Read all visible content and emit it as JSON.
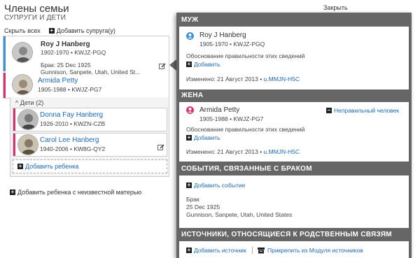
{
  "header": {
    "title": "Члены семьи",
    "subtitle": "СУПРУГИ И ДЕТИ",
    "close": "Закрыть"
  },
  "toolbar": {
    "hide_all": "Скрыть всех",
    "add_spouse": "Добавить супруга(у)"
  },
  "couple": {
    "husband": {
      "name": "Roy J Hanberg",
      "meta": "1902-1970 • KWJZ-PGQ"
    },
    "marriage": {
      "date": "Брак: 25 Dec 1925",
      "place": "Gunnison, Sanpete, Utah, United St..."
    },
    "wife": {
      "name": "Armida Petty",
      "meta": "1905-1988 • KWJZ-PG7"
    }
  },
  "children": {
    "header": "Дети (2)",
    "items": [
      {
        "name": "Donna Fay Hanberg",
        "meta": "1926-2010 • KWZN-CZB"
      },
      {
        "name": "Carol Lee Hanberg",
        "meta": "1940-2006 • KW8G-QY2"
      }
    ],
    "add_child": "Добавить ребенка"
  },
  "unknown_mother": "Добавить ребенка с неизвестной матерью",
  "panel": {
    "husband": {
      "header": "МУЖ",
      "name": "Roy J Hanberg",
      "meta": "1905-1970 • KWJZ-PGQ",
      "reason": "Обоснование правильности этих сведений",
      "add": "Добавить",
      "changed": "Изменено: 21 Август 2013",
      "changed_by": "u.MMJN-H5C"
    },
    "wife": {
      "header": "ЖЕНА",
      "name": "Armida Petty",
      "meta": "1905-1988 • KWJZ-PG7",
      "wrong": "Неправильный человек",
      "reason": "Обоснование правильности этих сведений",
      "add": "Добавить",
      "changed": "Изменено: 21 Август 2013",
      "changed_by": "u.MMJN-H5C"
    },
    "events": {
      "header": "СОБЫТИЯ, СВЯЗАННЫЕ С БРАКОМ",
      "add": "Добавить событие",
      "type": "Брак",
      "date": "25 Dec 1925",
      "place": "Gunnison, Sanpete, Utah, United States"
    },
    "sources": {
      "header": "ИСТОЧНИКИ, ОТНОСЯЩИЕСЯ К РОДСТВЕННЫМ СВЯЗЯМ",
      "add": "Добавить источник",
      "attach": "Прикрепить из Модуля источников"
    }
  },
  "colors": {
    "male": "#3b8fd8",
    "female": "#d6306f",
    "link": "#1a69b8",
    "header_bg": "#666666"
  }
}
